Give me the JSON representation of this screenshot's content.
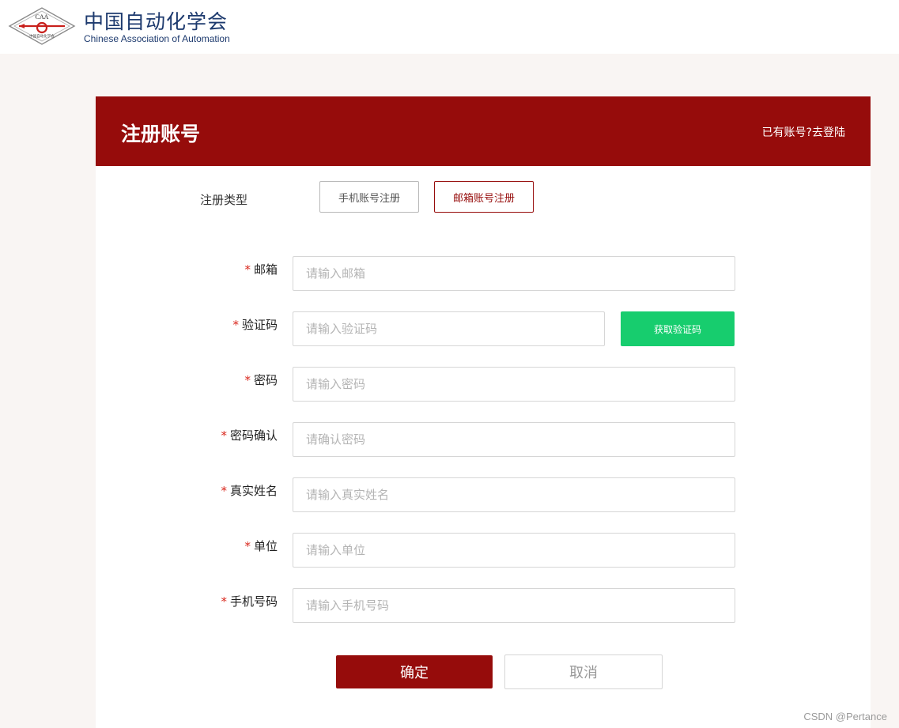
{
  "brand": {
    "emblem_text": "CAA",
    "emblem_subtext": "中国自动化学会",
    "name_cn": "中国自动化学会",
    "name_en": "Chinese Association of Automation",
    "color": "#1d3a6e"
  },
  "header": {
    "title": "注册账号",
    "login_link": "已有账号?去登陆",
    "accent": "#960c0b"
  },
  "register_type": {
    "label": "注册类型",
    "options": [
      "手机账号注册",
      "邮箱账号注册"
    ],
    "selected": "邮箱账号注册"
  },
  "form": {
    "required_mark": "*",
    "fields": [
      {
        "label": "邮箱",
        "placeholder": "请输入邮箱"
      },
      {
        "label": "验证码",
        "placeholder": "请输入验证码"
      },
      {
        "label": "密码",
        "placeholder": "请输入密码"
      },
      {
        "label": "密码确认",
        "placeholder": "请确认密码"
      },
      {
        "label": "真实姓名",
        "placeholder": "请输入真实姓名"
      },
      {
        "label": "单位",
        "placeholder": "请输入单位"
      },
      {
        "label": "手机号码",
        "placeholder": "请输入手机号码"
      }
    ],
    "get_code_label": "获取验证码",
    "get_code_color": "#17cd6e"
  },
  "actions": {
    "confirm": "确定",
    "cancel": "取消"
  },
  "watermark": "CSDN @Pertance"
}
